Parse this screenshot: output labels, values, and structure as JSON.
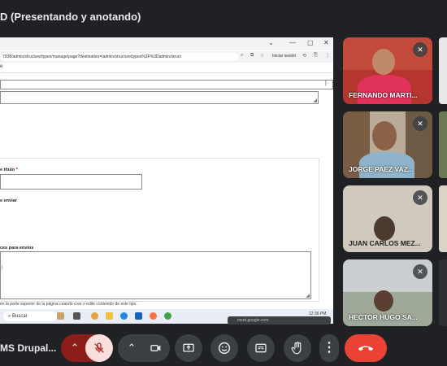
{
  "meeting": {
    "title": "D (Presentando y anotando)",
    "app_name": "MS Drupal..."
  },
  "browser": {
    "url": "7938/admin/structure/types/manage/page?destination=/admin/structure/types%3F%3Dadmin/struct",
    "signin_label": "Iniciar sesión",
    "window_min": "—",
    "window_max": "▢",
    "window_close": "✕",
    "page_bar_char": "e"
  },
  "form": {
    "title_label": "e título",
    "required_mark": "*",
    "send_label": "e enviar",
    "settings_label": "ces para envíos",
    "help_text": "en la parte superior de la página cuando cree o edite contenido de este tipo."
  },
  "taskbar": {
    "search_placeholder": "Buscar",
    "clock": "12:36 PM"
  },
  "share_note": "meet.google.com",
  "participants": [
    {
      "name": "FERNANDO MARTI..."
    },
    {
      "name": "JORGE PAEZ VAZ..."
    },
    {
      "name": "JUAN CARLOS MEZ..."
    },
    {
      "name": "HECTOR HUGO SA..."
    }
  ],
  "icons": {
    "mic_off": "mic-off-icon",
    "camera": "camera-icon",
    "present": "present-screen-icon",
    "emoji": "emoji-icon",
    "captions": "captions-icon",
    "raise_hand": "raise-hand-icon",
    "more": "more-options-icon",
    "hangup": "hangup-icon"
  },
  "colors": {
    "background": "#202124",
    "control_bg": "#3c4043",
    "mic_off_bg": "#f9dedc",
    "mic_off_icon": "#b3261e",
    "hangup": "#ea4335",
    "chevron_bg": "#8c1d18"
  }
}
